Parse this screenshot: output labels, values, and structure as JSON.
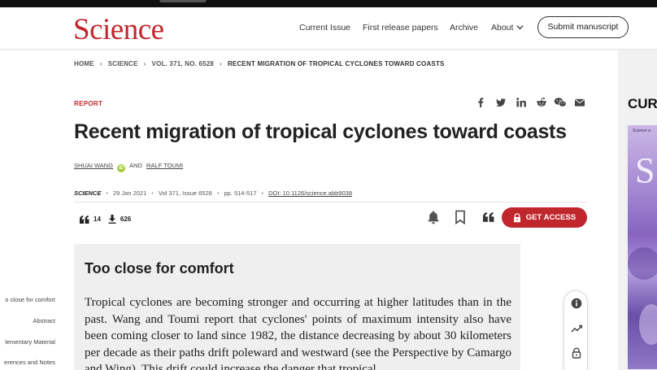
{
  "site": {
    "logo": "Science",
    "nav": [
      "Current Issue",
      "First release papers",
      "Archive",
      "About"
    ],
    "submit_label": "Submit manuscript"
  },
  "breadcrumb": [
    "HOME",
    "SCIENCE",
    "VOL. 371, NO. 6528",
    "RECENT MIGRATION OF TROPICAL CYCLONES TOWARD COASTS"
  ],
  "article": {
    "type_label": "REPORT",
    "title": "Recent migration of tropical cyclones toward coasts",
    "authors": [
      "SHUAI WANG",
      "RALF TOUMI"
    ],
    "and": "AND",
    "orcid_badge": "iD",
    "journal": "SCIENCE",
    "date": "29 Jan 2021",
    "volume_issue": "Vol 371, Issue 6528",
    "pages": "pp. 514-517",
    "doi": "DOI: 10.1126/science.abb9038",
    "citations": "14",
    "downloads": "626",
    "access_label": "GET ACCESS"
  },
  "share_icons": [
    "facebook-icon",
    "twitter-icon",
    "linkedin-icon",
    "reddit-icon",
    "wechat-icon",
    "email-icon"
  ],
  "editor_summary": {
    "heading": "Too close for comfort",
    "text": "Tropical cyclones are becoming stronger and occurring at higher latitudes than in the past. Wang and Toumi report that cyclones' points of maximum intensity also have been coming closer to land since 1982, the distance decreasing by about 30 kilometers per decade as their paths drift poleward and westward (see the Perspective by Camargo and Wing). This drift could increase the danger that tropical"
  },
  "side_toc": [
    "o close for comfort",
    "Abstract",
    "lementary Material",
    "erences and Notes"
  ],
  "right_panel": {
    "heading": "CUR",
    "cover_letter": "S",
    "cover_small": "Science a"
  },
  "colors": {
    "brand_red": "#c0272d",
    "summary_bg": "#efefef"
  }
}
